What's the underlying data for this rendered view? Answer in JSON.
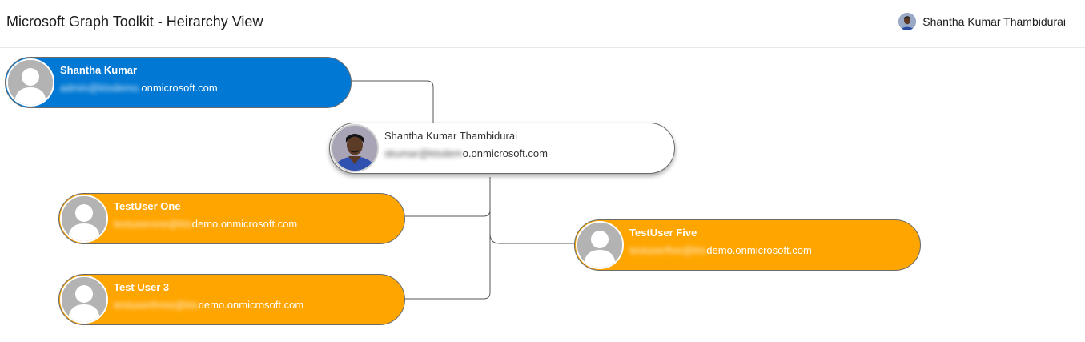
{
  "header": {
    "title": "Microsoft Graph Toolkit - Heirarchy View",
    "signed_in_user": "Shantha Kumar Thambidurai"
  },
  "manager": {
    "name": "Shantha Kumar",
    "email_hidden": "admin@ktsdemo.",
    "email_visible": "onmicrosoft.com",
    "color": "#0078d4"
  },
  "me": {
    "name": "Shantha Kumar Thambidurai",
    "email_hidden": "skumar@ktsdem",
    "email_visible": "o.onmicrosoft.com",
    "color": "#ffffff"
  },
  "reports": [
    {
      "name": "TestUser One",
      "email_hidden": "testuserone@kts",
      "email_visible": "demo.onmicrosoft.com"
    },
    {
      "name": "Test User 3",
      "email_hidden": "testuserthree@kts",
      "email_visible": "demo.onmicrosoft.com"
    },
    {
      "name": "TestUser Five",
      "email_hidden": "testuserfive@kts",
      "email_visible": "demo.onmicrosoft.com"
    }
  ],
  "colors": {
    "report_card": "#ffa500",
    "manager_card": "#0078d4",
    "connector": "#555555"
  },
  "icons": {
    "placeholder_avatar": "person-silhouette-icon",
    "user_photo": "user-photo-icon"
  }
}
